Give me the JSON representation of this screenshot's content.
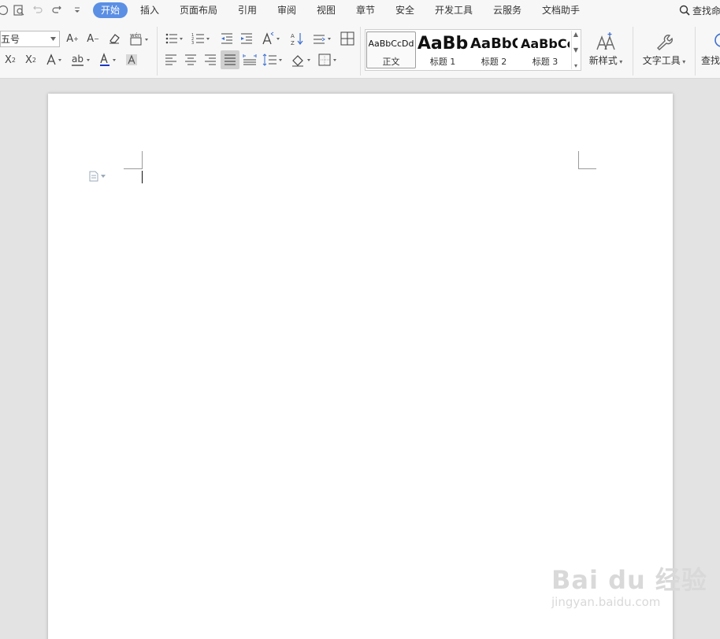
{
  "menubar": {
    "tabs": [
      "开始",
      "插入",
      "页面布局",
      "引用",
      "审阅",
      "视图",
      "章节",
      "安全",
      "开发工具",
      "云服务",
      "文档助手"
    ],
    "active_tab": "开始",
    "search_label": "查找命"
  },
  "ribbon": {
    "font_size": "五号",
    "styles": [
      {
        "preview": "AaBbCcDd",
        "label": "正文"
      },
      {
        "preview": "AaBb",
        "label": "标题 1"
      },
      {
        "preview": "AaBbC",
        "label": "标题 2"
      },
      {
        "preview": "AaBbCc",
        "label": "标题 3"
      }
    ],
    "new_style_label": "新样式",
    "text_tools_label": "文字工具",
    "find_label": "查找"
  },
  "colors": {
    "accent": "#5b8fe4",
    "font_color_underline": "#1d39c4"
  },
  "watermark": {
    "brand": "Bai du 经验",
    "url": "jingyan.baidu.com"
  }
}
